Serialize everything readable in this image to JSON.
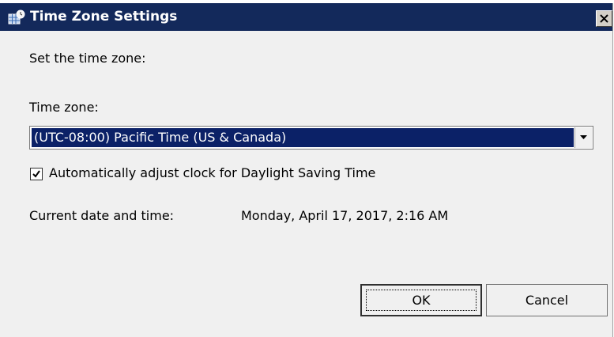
{
  "window": {
    "title": "Time Zone Settings",
    "close_label": "✕"
  },
  "content": {
    "prompt": "Set the time zone:",
    "timezone_label": "Time zone:",
    "timezone_selected": "(UTC-08:00) Pacific Time (US & Canada)",
    "dst_checkbox_label": "Automatically adjust clock for Daylight Saving Time",
    "dst_checked": true,
    "current_datetime_label": "Current date and time:",
    "current_datetime_value": "Monday, April 17, 2017, 2:16 AM"
  },
  "buttons": {
    "ok_label": "OK",
    "cancel_label": "Cancel"
  },
  "colors": {
    "titlebar": "#13295b",
    "selection": "#0b2167",
    "dialog_bg": "#f0f0f0"
  },
  "icons": {
    "title": "clock-globe-icon",
    "close": "close-icon",
    "dropdown": "chevron-down-icon",
    "check": "checkmark-icon"
  }
}
